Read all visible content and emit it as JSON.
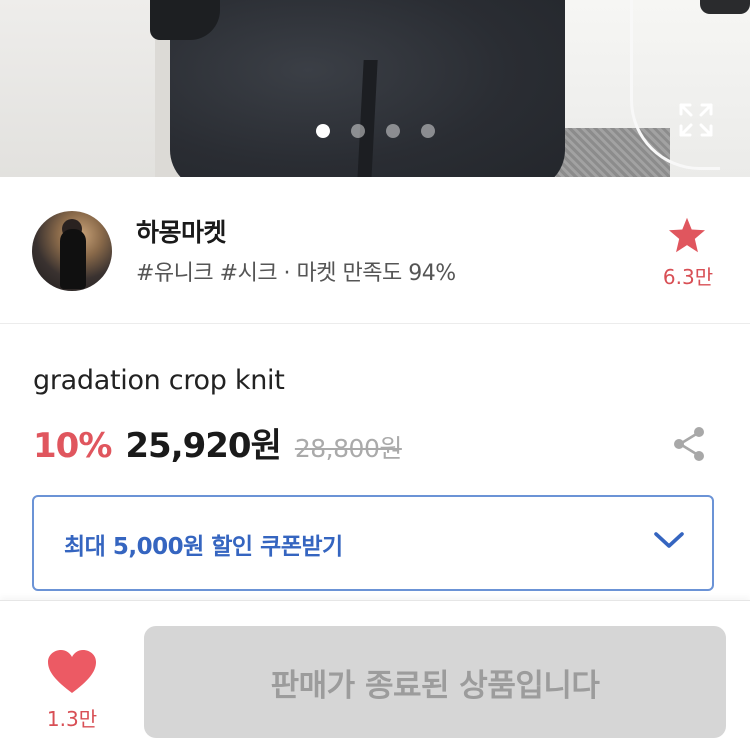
{
  "gallery": {
    "total_slides": 4,
    "active_slide": 1
  },
  "seller": {
    "name": "하몽마켓",
    "tags": "#유니크 #시크 · 마켓 만족도 94%",
    "favorites_count": "6.3만"
  },
  "product": {
    "name": "gradation crop knit",
    "discount": "10%",
    "price": "25,920원",
    "original_price": "28,800원"
  },
  "coupon": {
    "label": "최대 5,000원 할인 쿠폰받기"
  },
  "bottom_bar": {
    "like_count": "1.3만",
    "buy_button_label": "판매가 종료된 상품입니다"
  },
  "colors": {
    "accent_red": "#e0565e",
    "coupon_blue": "#3565c0",
    "disabled_gray": "#d6d6d6"
  },
  "icons": [
    "expand-icon",
    "star-icon",
    "share-icon",
    "chevron-down-icon",
    "heart-icon"
  ]
}
